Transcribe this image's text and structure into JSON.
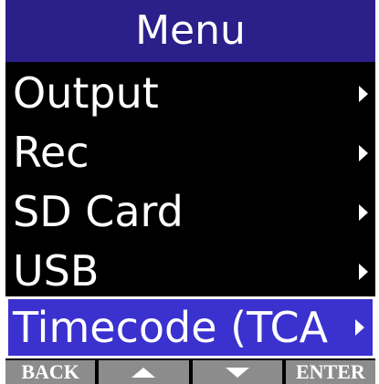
{
  "header": {
    "title": "Menu"
  },
  "menu": {
    "items": [
      {
        "label": "Output"
      },
      {
        "label": "Rec"
      },
      {
        "label": "SD Card"
      },
      {
        "label": "USB"
      },
      {
        "label": "Timecode (TCA"
      }
    ],
    "selected_index": 4
  },
  "softkeys": {
    "back_label": "BACK",
    "up_icon": "up-arrow-icon",
    "down_icon": "down-arrow-icon",
    "enter_label": "ENTER"
  },
  "colors": {
    "title_bar": "#2b1f8a",
    "selected_row": "#3a31cf",
    "softkey_bg": "#8c8c8c",
    "screen_bg": "#000000"
  }
}
